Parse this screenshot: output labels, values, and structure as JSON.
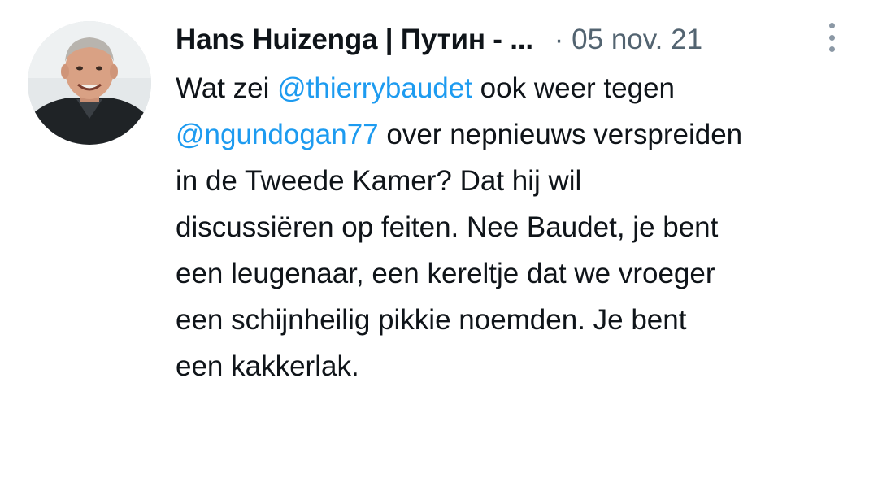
{
  "tweet": {
    "author": {
      "display_name": "Hans Huizenga | Путин - ...",
      "avatar_icon": "person-photo"
    },
    "separator": "·",
    "date": "05 nov. 21",
    "more_icon": "more-vertical-icon",
    "mention_color": "#1d9bf0",
    "text_lines": [
      {
        "segments": [
          {
            "text": "Wat zei "
          },
          {
            "text": "@thierrybaudet",
            "mention": true
          },
          {
            "text": " ook weer tegen"
          }
        ]
      },
      {
        "segments": [
          {
            "text": "@ngundogan77",
            "mention": true
          },
          {
            "text": " over nepnieuws verspreiden"
          }
        ]
      },
      {
        "segments": [
          {
            "text": "in de Tweede Kamer? Dat hij wil"
          }
        ]
      },
      {
        "segments": [
          {
            "text": "discussiëren op feiten. Nee Baudet, je bent"
          }
        ]
      },
      {
        "segments": [
          {
            "text": "een leugenaar, een kereltje dat we vroeger"
          }
        ]
      },
      {
        "segments": [
          {
            "text": "een schijnheilig pikkie noemden. Je bent"
          }
        ]
      },
      {
        "segments": [
          {
            "text": "een kakkerlak."
          }
        ]
      }
    ]
  }
}
